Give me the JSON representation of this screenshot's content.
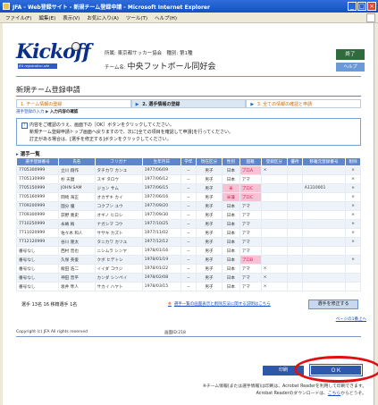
{
  "window": {
    "title": "JFA - Web登録サイト - 新規チーム登録申請 - Microsoft Internet Explorer",
    "buttons": [
      "_",
      "□",
      "×"
    ]
  },
  "menu": [
    "ファイル(F)",
    "編集(E)",
    "表示(V)",
    "お気に入り(A)",
    "ツール(T)",
    "ヘルプ(H)"
  ],
  "header": {
    "brand": "Kickoff",
    "brand_sub": "JFA registration site",
    "association_label": "所属:",
    "association": "東京都サッカー協会",
    "category_label": "種別:",
    "category": "第1種",
    "team_label": "チーム名:",
    "team_name": "中央フットボール同好会",
    "top_button": "終了",
    "help_button": "ヘルプ"
  },
  "page": {
    "title": "新規チーム登録申請",
    "steps": [
      {
        "num": "1.",
        "label": "チーム情報の登録"
      },
      {
        "num": "2.",
        "label": "選手情報の登録"
      },
      {
        "num": "3.",
        "label": "全ての情報の確認と申請"
      }
    ],
    "sub_step_prefix": "選手登録の入力",
    "sub_step_current": "入力内容の確認",
    "note_lines": [
      "内容をご確認のうえ、画面下の［OK］ボタンをクリックしてください。",
      "新規チーム登録申請トップ画面へ戻りますので、次に[全ての項目を確認して申請]を行ってください。",
      "訂正がある場合は、[選手を修正する]ボタンをクリックしてください。"
    ]
  },
  "table": {
    "title": "選手一覧",
    "headers": [
      "選手登録番号",
      "氏名",
      "フリガナ",
      "生年月日",
      "学年",
      "現在区分",
      "性別",
      "国籍",
      "登録区分",
      "優待",
      "移籍元登録番号",
      "削除"
    ],
    "rows": [
      [
        "7705300999",
        "立川 翔作",
        "タチカワ カンユ",
        "1977/06/09",
        "－",
        "男子",
        "日本",
        "プロA",
        "×",
        "",
        "",
        "×"
      ],
      [
        "7705130999",
        "杉 天麿",
        "スギ タロウ",
        "1977/06/12",
        "－",
        "男子",
        "日本",
        "アマ",
        "",
        "",
        "",
        "×"
      ],
      [
        "7705150999",
        "JOHN SAM",
        "ジョン サム",
        "1977/06/15",
        "－",
        "男子",
        "米",
        "プロC",
        "",
        "",
        "A1310001",
        "×"
      ],
      [
        "7705160999",
        "岡崎 海正",
        "オカザキ カイ",
        "1977/06/16",
        "－",
        "男子",
        "米兼",
        "プロC",
        "",
        "",
        "",
        "×"
      ],
      [
        "7709200999",
        "国分 優",
        "コクブン ユウ",
        "1977/09/20",
        "－",
        "男子",
        "日本",
        "アマ",
        "",
        "",
        "",
        "×"
      ],
      [
        "7709300999",
        "荻野 寛史",
        "オギノ ヒロシ",
        "1977/09/30",
        "－",
        "男子",
        "日本",
        "アマ",
        "",
        "",
        "",
        "×"
      ],
      [
        "7710250999",
        "永嶋 絢",
        "ナガシマ コウ",
        "1977/10/25",
        "－",
        "男子",
        "日本",
        "アマ",
        "",
        "",
        "",
        "×"
      ],
      [
        "7711020999",
        "佐々木 和人",
        "ササキ カズト",
        "1977/11/02",
        "－",
        "男子",
        "日本",
        "アマ",
        "",
        "",
        "",
        "×"
      ],
      [
        "7712120999",
        "谷川 隆太",
        "タニカワ カツユ",
        "1977/12/12",
        "－",
        "男子",
        "日本",
        "アマ",
        "",
        "",
        "",
        "×"
      ],
      [
        "番号なし",
        "西村 晋也",
        "ニシムラ シンヤ",
        "1978/01/16",
        "－",
        "男子",
        "日本",
        "アマ",
        "",
        "",
        "",
        ""
      ],
      [
        "番号なし",
        "久保 英俊",
        "クボ ヒデトシ",
        "1978/01/19",
        "－",
        "男子",
        "日本",
        "プロB",
        "",
        "",
        "",
        "×"
      ],
      [
        "番号なし",
        "飯田 浩二",
        "イイダ コウジ",
        "1978/01/22",
        "－",
        "男子",
        "日本",
        "アマ",
        "×",
        "",
        "",
        ""
      ],
      [
        "番号なし",
        "神田 晋平",
        "カンダ シンペイ",
        "1978/02/08",
        "－",
        "男子",
        "日本",
        "アマ",
        "×",
        "",
        "",
        ""
      ],
      [
        "番号なし",
        "坂井 隼人",
        "サカイ ハヤト",
        "1978/03/15",
        "－",
        "男子",
        "日本",
        "アマ",
        "×",
        "",
        "",
        ""
      ]
    ],
    "footer_count": "選手 13名 16 移籍選手 1名",
    "footer_link_mark": "※",
    "footer_link": "選手一覧の画面表示と削除方法に関する説明はこちら",
    "fix_button": "選手を修正する",
    "to_top": "ページの1番上へ"
  },
  "footer": {
    "copyright": "Copyright (c) JFA All rights reserved",
    "screen_id": "画面ID:218",
    "print_button": "印刷",
    "ok_button": "ＯＫ",
    "note_line1": "※チーム情報(または選手情報)は印刷は、Acrobat Readerを利用して印刷できます。",
    "note_line2_a": "Acrobat Readerのダウンロードは、",
    "note_line2_link": "こちら",
    "note_line2_b": "からどうぞ。"
  },
  "colors": {
    "accent": "#2f58a8",
    "table_header": "#5f86c8",
    "highlight_ring": "#e01010",
    "pink_cell": "#f7c3d2"
  }
}
